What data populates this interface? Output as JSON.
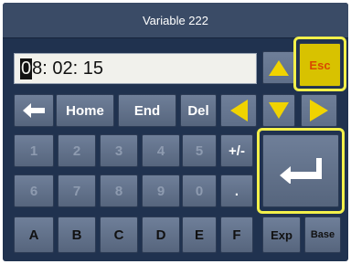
{
  "title": "Variable 222",
  "display": {
    "cursor_char": "0",
    "value_rest": "8: 02: 15"
  },
  "nav_keys": {
    "home": "Home",
    "end": "End",
    "del": "Del"
  },
  "esc_label": "Esc",
  "digits_row1": [
    "1",
    "2",
    "3",
    "4",
    "5"
  ],
  "digits_row2": [
    "6",
    "7",
    "8",
    "9",
    "0"
  ],
  "sign_label": "+/-",
  "dot_label": ".",
  "hex_row": [
    "A",
    "B",
    "C",
    "D",
    "E",
    "F"
  ],
  "exp_label": "Exp",
  "base_label": "Base",
  "colors": {
    "highlight": "#f3f04a",
    "arrow": "#f0d300",
    "esc_bg": "#d8c200",
    "esc_text": "#d94a00"
  }
}
